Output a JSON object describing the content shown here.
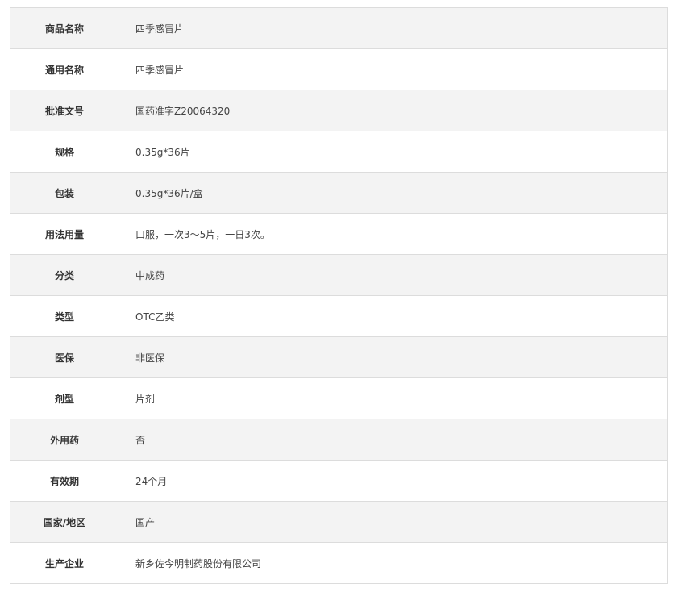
{
  "product_specs": {
    "rows": [
      {
        "label": "商品名称",
        "value": "四季感冒片"
      },
      {
        "label": "通用名称",
        "value": "四季感冒片"
      },
      {
        "label": "批准文号",
        "value": "国药准字Z20064320"
      },
      {
        "label": "规格",
        "value": "0.35g*36片"
      },
      {
        "label": "包装",
        "value": "0.35g*36片/盒"
      },
      {
        "label": "用法用量",
        "value": "口服，一次3～5片，一日3次。"
      },
      {
        "label": "分类",
        "value": "中成药"
      },
      {
        "label": "类型",
        "value": "OTC乙类"
      },
      {
        "label": "医保",
        "value": "非医保"
      },
      {
        "label": "剂型",
        "value": "片剂"
      },
      {
        "label": "外用药",
        "value": "否"
      },
      {
        "label": "有效期",
        "value": "24个月"
      },
      {
        "label": "国家/地区",
        "value": "国产"
      },
      {
        "label": "生产企业",
        "value": "新乡佐今明制药股份有限公司"
      }
    ]
  },
  "colors": {
    "row_odd_bg": "#f3f3f3",
    "row_even_bg": "#ffffff",
    "border": "#dcdcdc",
    "label_text": "#333333",
    "value_text": "#444444"
  }
}
